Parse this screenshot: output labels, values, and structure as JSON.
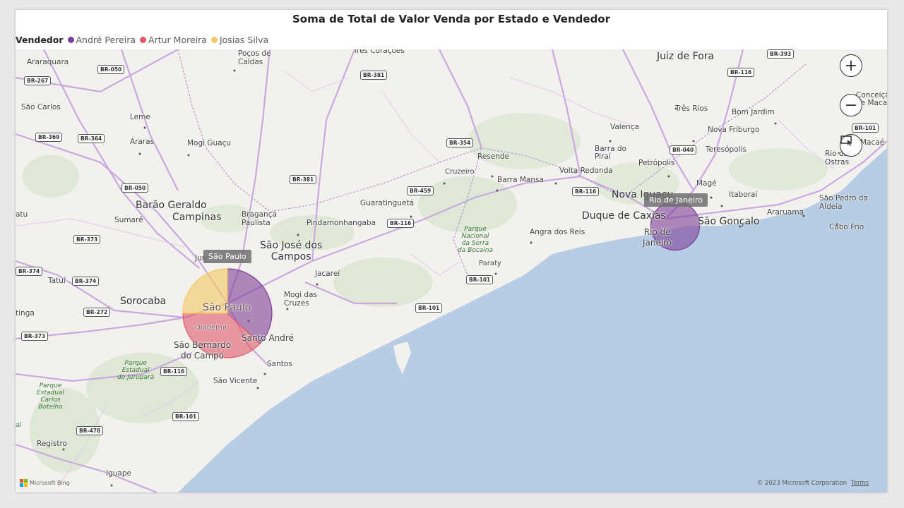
{
  "title": "Soma de Total de Valor Venda por Estado e Vendedor",
  "legend": {
    "title": "Vendedor",
    "items": [
      {
        "label": "André Pereira",
        "color": "#7e3f98"
      },
      {
        "label": "Artur Moreira",
        "color": "#e0596b"
      },
      {
        "label": "Josias Silva",
        "color": "#f5c860"
      }
    ]
  },
  "tooltips": {
    "sp": "São Paulo",
    "rj": "Rio de Janeiro"
  },
  "cities": {
    "araraquara": "Araraquara",
    "sao_carlos": "São Carlos",
    "leme": "Leme",
    "araras": "Araras",
    "mogi_guacu": "Mogi Guaçu",
    "pocos_de_caldas": "Poços de\nCaldas",
    "tres_coracoes": "Três Corações",
    "juiz_de_fora": "Juiz de Fora",
    "tres_rios": "Três Rios",
    "bom_jardim": "Bom Jardim",
    "conceicao": "Conceiçã\nde Macabu",
    "valenca": "Valença",
    "nova_friburgo": "Nova Friburgo",
    "barra_do_pirai": "Barra do\nPiraí",
    "teresopolis": "Teresópolis",
    "macae": "Macaé",
    "rio_das_ostras": "Rio das\nOstras",
    "petropolis": "Petrópolis",
    "mage": "Magé",
    "resende": "Resende",
    "cruzeiro": "Cruzeiro",
    "volta_redonda": "Volta Redonda",
    "barra_mansa": "Barra Mansa",
    "nova_iguacu": "Nova Iguaçu",
    "itaborai": "Itaboraí",
    "sao_pedro": "São Pedro da\nAldeia",
    "duque_de_caxias": "Duque de Caxias",
    "araruama": "Araruama",
    "sao_goncalo": "São Gonçalo",
    "cabo_frio": "Cabo Frio",
    "rio_de_janeiro": "Rio de\nJaneiro",
    "angra": "Angra dos Reis",
    "paraty": "Paraty",
    "guaratingueta": "Guaratinguetá",
    "barao_geraldo": "Barão Geraldo",
    "campinas": "Campinas",
    "sumare": "Sumaré",
    "braganca": "Bragança\nPaulista",
    "pindamonhangaba": "Pindamonhangaba",
    "sjc": "São José dos\nCampos",
    "jacarei": "Jacareí",
    "atu": "atu",
    "tatui": "Tatuí",
    "jundiai": "Jun",
    "sorocaba": "Sorocaba",
    "itinga": "tinga",
    "sao_paulo": "São Paulo",
    "mogi_das_cruzes": "Mogi das\nCruzes",
    "diadema": "Diadema",
    "santo_andre": "Santo André",
    "sbc": "São Bernardo\ndo Campo",
    "santos": "Santos",
    "sao_vicente": "São Vicente",
    "registro": "Registro",
    "iguape": "Iguape"
  },
  "parks": {
    "bocaina": "Parque\nNacional\nda Serra\nda Bocaina",
    "jurupara": "Parque\nEstadual\ndo Jurupará",
    "carlos_botelho": "Parque\nEstadual\nCarlos\nBotelho",
    "al": "al"
  },
  "highways": [
    "BR-267",
    "BR-050",
    "BR-369",
    "BR-364",
    "BR-050",
    "BR-381",
    "BR-381",
    "BR-373",
    "BR-374",
    "BR-374",
    "BR-272",
    "BR-373",
    "BR-116",
    "BR-478",
    "BR-101",
    "BR-116",
    "BR-459",
    "BR-354",
    "BR-101",
    "BR-101",
    "BR-116",
    "BR-040",
    "BR-116",
    "BR-393",
    "BR-101"
  ],
  "controls": {
    "zoom_in": "+",
    "zoom_out": "−"
  },
  "attribution": {
    "logo_text": "Microsoft Bing",
    "copyright": "© 2023 Microsoft Corporation",
    "terms": "Terms"
  },
  "chart_data": {
    "type": "pie",
    "description_type": "map with pie markers",
    "series_names": [
      "André Pereira",
      "Artur Moreira",
      "Josias Silva"
    ],
    "locations": [
      {
        "name": "São Paulo",
        "shares": {
          "André Pereira": 0.37,
          "Artur Moreira": 0.38,
          "Josias Silva": 0.25
        }
      },
      {
        "name": "Rio de Janeiro",
        "shares": {
          "André Pereira": 1.0,
          "Artur Moreira": 0.0,
          "Josias Silva": 0.0
        }
      }
    ],
    "relative_size": {
      "São Paulo": 1.0,
      "Rio de Janeiro": 0.3
    }
  }
}
